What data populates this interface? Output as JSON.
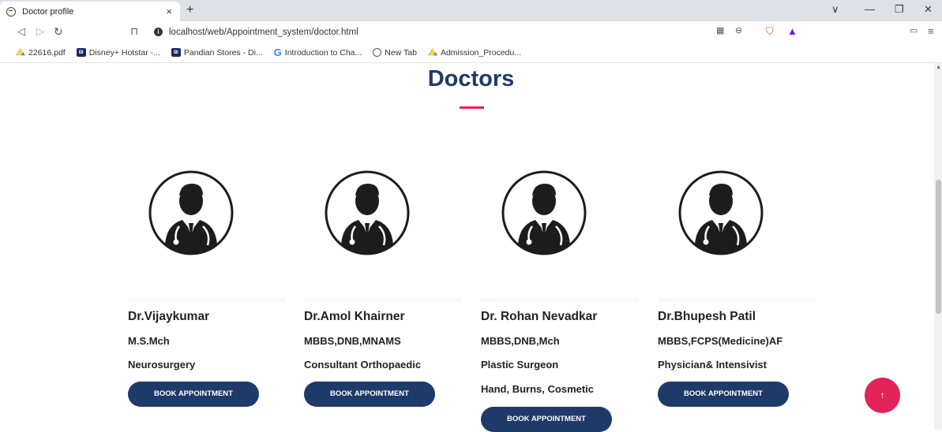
{
  "browser": {
    "tab_title": "Doctor profile",
    "tab_close": "×",
    "new_tab": "+",
    "url": "localhost/web/Appointment_system/doctor.html",
    "window_controls": [
      "∨",
      "—",
      "❐",
      "✕"
    ],
    "bookmarks": [
      {
        "label": "22616.pdf",
        "icon": "drive-icon"
      },
      {
        "label": "Disney+ Hotstar -...",
        "icon": "hotstar-icon"
      },
      {
        "label": "Pandian Stores - Di...",
        "icon": "hotstar-icon"
      },
      {
        "label": "Introduction to Cha...",
        "icon": "google-icon"
      },
      {
        "label": "New Tab",
        "icon": "globe-icon"
      },
      {
        "label": "Admission_Procedu...",
        "icon": "drive-icon"
      }
    ]
  },
  "page": {
    "title": "Doctors",
    "accent_color": "#e2245a",
    "primary_color": "#1e3a68",
    "scroll_top_label": "↑"
  },
  "doctors": [
    {
      "name": "Dr.Vijaykumar",
      "qualification": "M.S.Mch",
      "specialty": "Neurosurgery",
      "specialty2": "",
      "button": "BOOK APPOINTMENT"
    },
    {
      "name": "Dr.Amol Khairner",
      "qualification": "MBBS,DNB,MNAMS",
      "specialty": "Consultant Orthopaedic",
      "specialty2": "",
      "button": "BOOK APPOINTMENT"
    },
    {
      "name": "Dr. Rohan Nevadkar",
      "qualification": "MBBS,DNB,Mch",
      "specialty": "Plastic Surgeon",
      "specialty2": "Hand, Burns, Cosmetic",
      "button": "BOOK APPOINTMENT"
    },
    {
      "name": "Dr.Bhupesh Patil",
      "qualification": "MBBS,FCPS(Medicine)AF",
      "specialty": "Physician& Intensivist",
      "specialty2": "",
      "button": "BOOK APPOINTMENT"
    }
  ]
}
